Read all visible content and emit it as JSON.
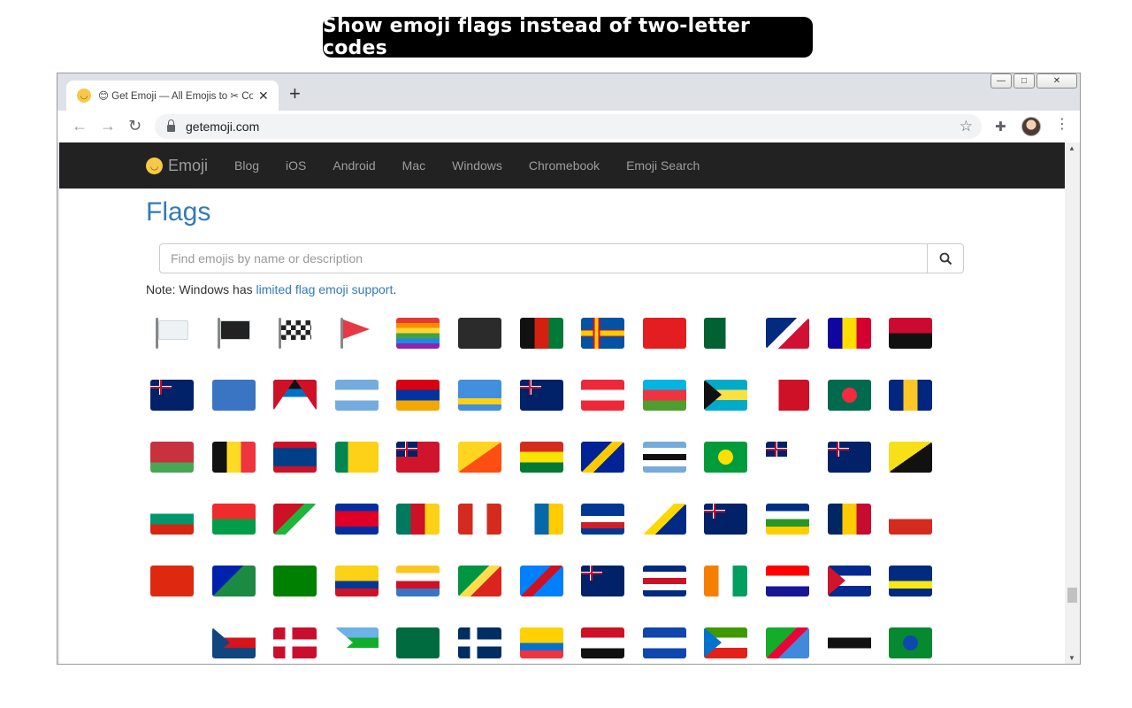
{
  "banner": {
    "text": "Show emoji flags instead of two-letter codes"
  },
  "window_controls": {
    "minimize": "—",
    "maximize": "□",
    "close": "✕"
  },
  "browser": {
    "tab_title": "😊 Get Emoji — All Emojis to ✂ Copy and Paste",
    "tab_close": "✕",
    "new_tab": "+",
    "back": "←",
    "forward": "→",
    "reload": "↻",
    "url": "getemoji.com",
    "star": "☆",
    "extensions": "✚",
    "menu": "⋮"
  },
  "site": {
    "brand": "Emoji",
    "brand_icon": "😊",
    "nav": [
      "Blog",
      "iOS",
      "Android",
      "Mac",
      "Windows",
      "Chromebook",
      "Emoji Search"
    ]
  },
  "page": {
    "title": "Flags",
    "search_placeholder": "Find emojis by name or description",
    "note_prefix": "Note: Windows has ",
    "note_link": "limited flag emoji support",
    "note_suffix": "."
  },
  "flags": [
    {
      "name": "white-flag",
      "type": "pole",
      "colors": [
        "#eef2f5"
      ]
    },
    {
      "name": "black-flag",
      "type": "pole",
      "colors": [
        "#222222"
      ]
    },
    {
      "name": "chequered-flag",
      "type": "pole-check",
      "colors": [
        "#222222",
        "#ffffff"
      ]
    },
    {
      "name": "triangular-flag",
      "type": "pole-tri",
      "colors": [
        "#e63946"
      ]
    },
    {
      "name": "rainbow-flag",
      "type": "h",
      "colors": [
        "#e53935",
        "#fb8c00",
        "#fdd835",
        "#43a047",
        "#1e88e5",
        "#8e24aa"
      ]
    },
    {
      "name": "pirate-flag",
      "type": "h",
      "colors": [
        "#2b2b2b"
      ]
    },
    {
      "name": "afghanistan-flag",
      "type": "v",
      "colors": [
        "#111111",
        "#d32011",
        "#007a36"
      ]
    },
    {
      "name": "aland-islands-flag",
      "type": "nordic",
      "colors": [
        "#0053a5",
        "#ffce00",
        "#d21034"
      ]
    },
    {
      "name": "albania-flag",
      "type": "h",
      "colors": [
        "#e41e20"
      ]
    },
    {
      "name": "algeria-flag",
      "type": "v",
      "colors": [
        "#006233",
        "#ffffff"
      ]
    },
    {
      "name": "american-samoa-flag",
      "type": "diag",
      "colors": [
        "#002b7f",
        "#ffffff",
        "#d21034"
      ]
    },
    {
      "name": "andorra-flag",
      "type": "v",
      "colors": [
        "#10069f",
        "#fedd00",
        "#d50032"
      ]
    },
    {
      "name": "angola-flag",
      "type": "h",
      "colors": [
        "#cc092f",
        "#111111"
      ]
    },
    {
      "name": "anguilla-flag",
      "type": "ensign",
      "colors": [
        "#012169",
        "#c8102e"
      ]
    },
    {
      "name": "antarctica-flag",
      "type": "h",
      "colors": [
        "#3a75c4"
      ]
    },
    {
      "name": "antigua-flag",
      "type": "tri-v",
      "colors": [
        "#ce1126",
        "#111111",
        "#0072c6",
        "#ffffff"
      ]
    },
    {
      "name": "argentina-flag",
      "type": "h",
      "colors": [
        "#74acdf",
        "#ffffff",
        "#74acdf"
      ]
    },
    {
      "name": "armenia-flag",
      "type": "h",
      "colors": [
        "#d90012",
        "#0033a0",
        "#f2a800"
      ]
    },
    {
      "name": "aruba-flag",
      "type": "h",
      "colors": [
        "#418fde",
        "#418fde",
        "#418fde",
        "#fcd116",
        "#418fde"
      ]
    },
    {
      "name": "australia-flag",
      "type": "ensign",
      "colors": [
        "#012169",
        "#c8102e"
      ]
    },
    {
      "name": "austria-flag",
      "type": "h",
      "colors": [
        "#ed2939",
        "#ffffff",
        "#ed2939"
      ]
    },
    {
      "name": "azerbaijan-flag",
      "type": "h",
      "colors": [
        "#00b5e2",
        "#ef3340",
        "#509e2f"
      ]
    },
    {
      "name": "bahamas-flag",
      "type": "tri-left",
      "colors": [
        "#00abc9",
        "#fae042",
        "#00abc9",
        "#111111"
      ]
    },
    {
      "name": "bahrain-flag",
      "type": "v2",
      "colors": [
        "#ffffff",
        "#ce1126"
      ]
    },
    {
      "name": "bangladesh-flag",
      "type": "disc",
      "colors": [
        "#006a4e",
        "#f42a41"
      ]
    },
    {
      "name": "barbados-flag",
      "type": "v",
      "colors": [
        "#00267f",
        "#ffc726",
        "#00267f"
      ]
    },
    {
      "name": "belarus-flag",
      "type": "h",
      "colors": [
        "#c8313e",
        "#c8313e",
        "#4aa657"
      ]
    },
    {
      "name": "belgium-flag",
      "type": "v",
      "colors": [
        "#111111",
        "#fdda24",
        "#ef3340"
      ]
    },
    {
      "name": "belize-flag",
      "type": "h",
      "colors": [
        "#ce1126",
        "#003f87",
        "#003f87",
        "#003f87",
        "#ce1126"
      ]
    },
    {
      "name": "benin-flag",
      "type": "v2",
      "colors": [
        "#008751",
        "#fcd116"
      ]
    },
    {
      "name": "bermuda-flag",
      "type": "ensign",
      "colors": [
        "#cf142b",
        "#012169"
      ]
    },
    {
      "name": "bhutan-flag",
      "type": "diag2",
      "colors": [
        "#ffd520",
        "#ff4e12"
      ]
    },
    {
      "name": "bolivia-flag",
      "type": "h",
      "colors": [
        "#d52b1e",
        "#f9e300",
        "#007934"
      ]
    },
    {
      "name": "bosnia-flag",
      "type": "diag",
      "colors": [
        "#002395",
        "#fecb00",
        "#002395"
      ]
    },
    {
      "name": "botswana-flag",
      "type": "h",
      "colors": [
        "#75aadb",
        "#ffffff",
        "#111111",
        "#ffffff",
        "#75aadb"
      ]
    },
    {
      "name": "brazil-flag",
      "type": "disc",
      "colors": [
        "#009c3b",
        "#ffdf00"
      ]
    },
    {
      "name": "british-indian-ocean-flag",
      "type": "ensign",
      "colors": [
        "#ffffff",
        "#012169"
      ]
    },
    {
      "name": "british-virgin-islands-flag",
      "type": "ensign",
      "colors": [
        "#012169",
        "#c8102e"
      ]
    },
    {
      "name": "brunei-flag",
      "type": "diag2",
      "colors": [
        "#f7e017",
        "#111111"
      ]
    },
    {
      "name": "bulgaria-flag",
      "type": "h",
      "colors": [
        "#ffffff",
        "#00966e",
        "#d62612"
      ]
    },
    {
      "name": "burkina-faso-flag",
      "type": "h",
      "colors": [
        "#ef2b2d",
        "#009e49"
      ]
    },
    {
      "name": "burundi-flag",
      "type": "diag",
      "colors": [
        "#ce1126",
        "#1eb53a",
        "#ffffff"
      ]
    },
    {
      "name": "cambodia-flag",
      "type": "h",
      "colors": [
        "#032ea1",
        "#e00025",
        "#e00025",
        "#032ea1"
      ]
    },
    {
      "name": "cameroon-flag",
      "type": "v",
      "colors": [
        "#007a5e",
        "#ce1126",
        "#fcd116"
      ]
    },
    {
      "name": "canada-flag",
      "type": "v",
      "colors": [
        "#d52b1e",
        "#ffffff",
        "#d52b1e"
      ]
    },
    {
      "name": "canary-islands-flag",
      "type": "v",
      "colors": [
        "#ffffff",
        "#0768a9",
        "#ffcc00"
      ]
    },
    {
      "name": "cape-verde-flag",
      "type": "h",
      "colors": [
        "#003893",
        "#003893",
        "#ffffff",
        "#cf2027",
        "#003893"
      ]
    },
    {
      "name": "caribbean-netherlands-flag",
      "type": "diag",
      "colors": [
        "#ffffff",
        "#fdd700",
        "#012a87"
      ]
    },
    {
      "name": "cayman-islands-flag",
      "type": "ensign",
      "colors": [
        "#012169",
        "#c8102e"
      ]
    },
    {
      "name": "central-african-republic-flag",
      "type": "h",
      "colors": [
        "#003082",
        "#ffffff",
        "#289728",
        "#ffce00"
      ]
    },
    {
      "name": "chad-flag",
      "type": "v",
      "colors": [
        "#002664",
        "#fecb00",
        "#c60c30"
      ]
    },
    {
      "name": "chile-flag",
      "type": "h",
      "colors": [
        "#ffffff",
        "#d52b1e"
      ]
    },
    {
      "name": "china-flag",
      "type": "h",
      "colors": [
        "#de2910"
      ]
    },
    {
      "name": "christmas-island-flag",
      "type": "diag",
      "colors": [
        "#0021ad",
        "#1c8a42",
        "#1c8a42"
      ]
    },
    {
      "name": "cocos-islands-flag",
      "type": "h",
      "colors": [
        "#008000"
      ]
    },
    {
      "name": "colombia-flag",
      "type": "h",
      "colors": [
        "#fcd116",
        "#fcd116",
        "#003893",
        "#ce1126"
      ]
    },
    {
      "name": "comoros-flag",
      "type": "h",
      "colors": [
        "#ffc61e",
        "#ffffff",
        "#ce1126",
        "#3a75c4"
      ]
    },
    {
      "name": "congo-brazzaville-flag",
      "type": "diag",
      "colors": [
        "#009543",
        "#fbde4a",
        "#dc241f"
      ]
    },
    {
      "name": "congo-kinshasa-flag",
      "type": "diag",
      "colors": [
        "#007fff",
        "#ce1021",
        "#007fff"
      ]
    },
    {
      "name": "cook-islands-flag",
      "type": "ensign",
      "colors": [
        "#012169",
        "#c8102e"
      ]
    },
    {
      "name": "costa-rica-flag",
      "type": "h",
      "colors": [
        "#002b7f",
        "#ffffff",
        "#ce1126",
        "#ffffff",
        "#002b7f"
      ]
    },
    {
      "name": "cote-divoire-flag",
      "type": "v",
      "colors": [
        "#f77f00",
        "#ffffff",
        "#009e60"
      ]
    },
    {
      "name": "croatia-flag",
      "type": "h",
      "colors": [
        "#ff0000",
        "#ffffff",
        "#171796"
      ]
    },
    {
      "name": "cuba-flag",
      "type": "tri-left",
      "colors": [
        "#002a8f",
        "#ffffff",
        "#002a8f",
        "#cf142b"
      ]
    },
    {
      "name": "curacao-flag",
      "type": "h",
      "colors": [
        "#002b7f",
        "#002b7f",
        "#f9e814",
        "#002b7f"
      ]
    },
    {
      "name": "cyprus-flag",
      "type": "h",
      "colors": [
        "#ffffff"
      ]
    },
    {
      "name": "czechia-flag",
      "type": "tri-left",
      "colors": [
        "#ffffff",
        "#d7141a",
        "#11457e",
        "#11457e"
      ]
    },
    {
      "name": "denmark-flag",
      "type": "nordic",
      "colors": [
        "#c8102e",
        "#ffffff",
        "#ffffff"
      ]
    },
    {
      "name": "djibouti-flag",
      "type": "tri-left",
      "colors": [
        "#6ab2e7",
        "#12ad2b",
        "#ffffff",
        "#ffffff"
      ]
    },
    {
      "name": "dominica-flag",
      "type": "h",
      "colors": [
        "#006b3f"
      ]
    },
    {
      "name": "dominican-republic-flag",
      "type": "nordic",
      "colors": [
        "#002d62",
        "#ffffff",
        "#ffffff"
      ]
    },
    {
      "name": "ecuador-flag",
      "type": "h",
      "colors": [
        "#ffd100",
        "#ffd100",
        "#0072ce",
        "#ef3340"
      ]
    },
    {
      "name": "egypt-flag",
      "type": "h",
      "colors": [
        "#ce1126",
        "#ffffff",
        "#111111"
      ]
    },
    {
      "name": "el-salvador-flag",
      "type": "h",
      "colors": [
        "#0f47af",
        "#ffffff",
        "#0f47af"
      ]
    },
    {
      "name": "equatorial-guinea-flag",
      "type": "tri-left",
      "colors": [
        "#3e9a00",
        "#ffffff",
        "#e32118",
        "#0073ce"
      ]
    },
    {
      "name": "eritrea-flag",
      "type": "diag",
      "colors": [
        "#12ad2b",
        "#ea0437",
        "#4189dd"
      ]
    },
    {
      "name": "estonia-flag",
      "type": "h",
      "colors": [
        "#ffffff",
        "#111111",
        "#ffffff"
      ]
    },
    {
      "name": "ethiopia-flag",
      "type": "disc",
      "colors": [
        "#078930",
        "#0f47af"
      ]
    }
  ]
}
